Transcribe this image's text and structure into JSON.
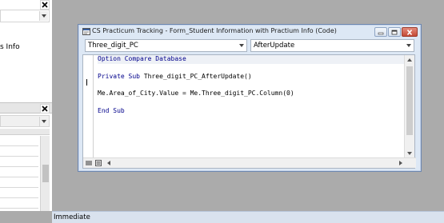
{
  "window": {
    "title": "CS Practicum Tracking - Form_Student Information with Practium Info (Code)",
    "object_dropdown": "Three_digit_PC",
    "procedure_dropdown": "AfterUpdate"
  },
  "code": {
    "line1_kw": "Option Compare Database",
    "line3_kw": "Private Sub",
    "line3_rest": " Three_digit_PC_AfterUpdate()",
    "line5": "Me.Area_of_City.Value = Me.Three_digit_PC.Column(0)",
    "line7_kw": "End Sub"
  },
  "left_pane": {
    "fragment_text": "s Info"
  },
  "immediate": {
    "label": "Immediate"
  },
  "colors": {
    "keyword": "#00008b",
    "titlebar": "#dde8f5",
    "close_button": "#c44a36"
  }
}
